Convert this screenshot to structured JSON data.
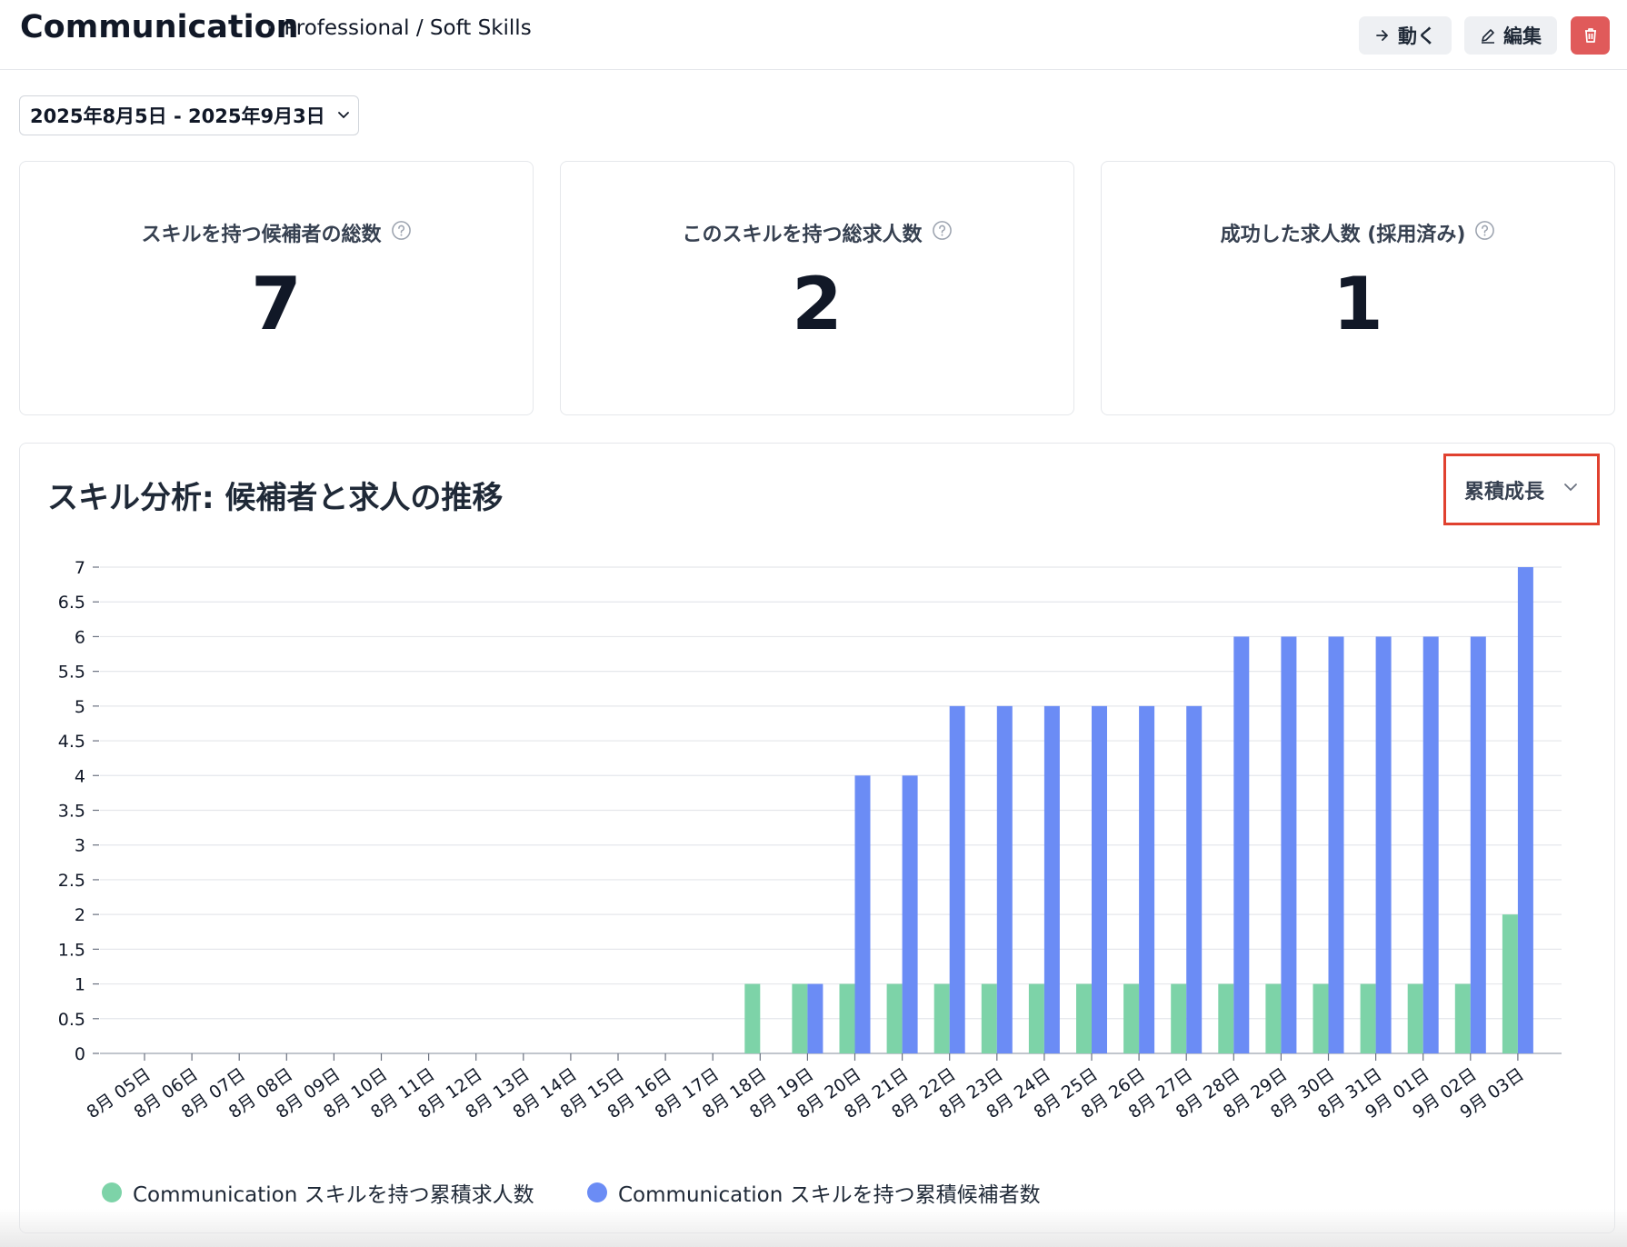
{
  "header": {
    "title": "Communication",
    "breadcrumb_sep": "·",
    "breadcrumb": "Professional / Soft Skills",
    "move_label": "動く",
    "edit_label": "編集"
  },
  "date_range": "2025年8月5日 - 2025年9月3日",
  "stats": [
    {
      "label": "スキルを持つ候補者の総数",
      "value": "7"
    },
    {
      "label": "このスキルを持つ総求人数",
      "value": "2"
    },
    {
      "label": "成功した求人数 (採用済み)",
      "value": "1"
    }
  ],
  "chart_panel": {
    "title": "スキル分析: 候補者と求人の推移",
    "mode_label": "累積成長"
  },
  "colors": {
    "green": "#7dd3a8",
    "blue": "#6b8cf5",
    "delete": "#e05a5a",
    "highlight": "#e0412f"
  },
  "chart_data": {
    "type": "bar",
    "categories": [
      "8月 05日",
      "8月 06日",
      "8月 07日",
      "8月 08日",
      "8月 09日",
      "8月 10日",
      "8月 11日",
      "8月 12日",
      "8月 13日",
      "8月 14日",
      "8月 15日",
      "8月 16日",
      "8月 17日",
      "8月 18日",
      "8月 19日",
      "8月 20日",
      "8月 21日",
      "8月 22日",
      "8月 23日",
      "8月 24日",
      "8月 25日",
      "8月 26日",
      "8月 27日",
      "8月 28日",
      "8月 29日",
      "8月 30日",
      "8月 31日",
      "9月 01日",
      "9月 02日",
      "9月 03日"
    ],
    "series": [
      {
        "name": "Communication スキルを持つ累積求人数",
        "color": "#7dd3a8",
        "values": [
          0,
          0,
          0,
          0,
          0,
          0,
          0,
          0,
          0,
          0,
          0,
          0,
          0,
          1,
          1,
          1,
          1,
          1,
          1,
          1,
          1,
          1,
          1,
          1,
          1,
          1,
          1,
          1,
          1,
          2
        ]
      },
      {
        "name": "Communication スキルを持つ累積候補者数",
        "color": "#6b8cf5",
        "values": [
          0,
          0,
          0,
          0,
          0,
          0,
          0,
          0,
          0,
          0,
          0,
          0,
          0,
          0,
          1,
          4,
          4,
          5,
          5,
          5,
          5,
          5,
          5,
          6,
          6,
          6,
          6,
          6,
          6,
          7
        ]
      }
    ],
    "ylim": [
      0,
      7
    ],
    "yticks": [
      0,
      0.5,
      1,
      1.5,
      2,
      2.5,
      3,
      3.5,
      4,
      4.5,
      5,
      5.5,
      6,
      6.5,
      7
    ],
    "grid": true,
    "legend": "bottom-left"
  }
}
